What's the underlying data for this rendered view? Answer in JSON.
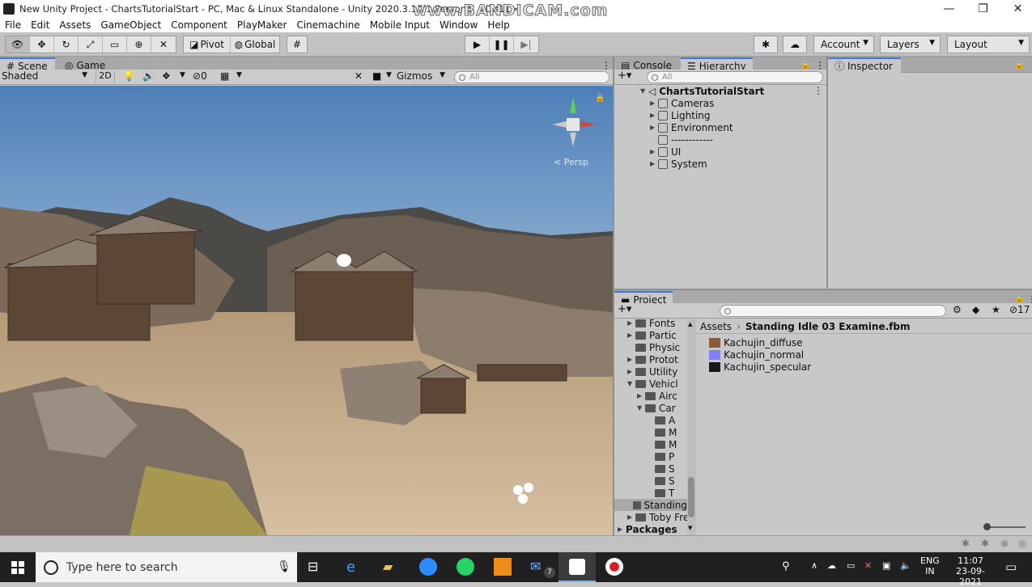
{
  "window": {
    "title": "New Unity Project - ChartsTutorialStart - PC, Mac & Linux Standalone - Unity 2020.3.17f1 Personal <DX11>",
    "watermark": "www.BANDICAM.com",
    "controls": {
      "minimize": "—",
      "restore": "❐",
      "close": "✕"
    }
  },
  "menu": [
    "File",
    "Edit",
    "Assets",
    "GameObject",
    "Component",
    "PlayMaker",
    "Cinemachine",
    "Mobile Input",
    "Window",
    "Help"
  ],
  "toolbar": {
    "pivot_label": "Pivot",
    "global_label": "Global",
    "account_label": "Account",
    "layers_label": "Layers",
    "layout_label": "Layout",
    "count_badge": "17"
  },
  "scene_panel": {
    "tab_scene": "Scene",
    "tab_game": "Game",
    "shading_mode": "Shaded",
    "toggle_2d": "2D",
    "hidden_count": "0",
    "gizmos_label": "Gizmos",
    "search_placeholder": "All",
    "persp_label": "< Persp"
  },
  "hierarchy_panel": {
    "tab_console": "Console",
    "tab_hierarchy": "Hierarchy",
    "search_placeholder": "All",
    "scene_name": "ChartsTutorialStart",
    "items": [
      {
        "label": "Cameras",
        "expandable": true
      },
      {
        "label": "Lighting",
        "expandable": true
      },
      {
        "label": "Environment",
        "expandable": true
      },
      {
        "label": "------------",
        "expandable": false
      },
      {
        "label": "UI",
        "expandable": true
      },
      {
        "label": "System",
        "expandable": true
      }
    ]
  },
  "inspector_panel": {
    "tab_inspector": "Inspector"
  },
  "project_panel": {
    "tab_project": "Project",
    "breadcrumb_root": "Assets",
    "breadcrumb_current": "Standing Idle 03 Examine.fbm",
    "tree": [
      {
        "label": "Fonts",
        "indent": 1,
        "open": false
      },
      {
        "label": "Partic",
        "indent": 1,
        "open": false
      },
      {
        "label": "Physic",
        "indent": 1,
        "open": false,
        "noarrow": true
      },
      {
        "label": "Protot",
        "indent": 1,
        "open": false
      },
      {
        "label": "Utility",
        "indent": 1,
        "open": false
      },
      {
        "label": "Vehicl",
        "indent": 1,
        "open": true
      },
      {
        "label": "Airc",
        "indent": 2,
        "open": false
      },
      {
        "label": "Car",
        "indent": 2,
        "open": true
      },
      {
        "label": "A",
        "indent": 3,
        "noarrow": true
      },
      {
        "label": "M",
        "indent": 3,
        "noarrow": true
      },
      {
        "label": "M",
        "indent": 3,
        "noarrow": true
      },
      {
        "label": "P",
        "indent": 3,
        "noarrow": true
      },
      {
        "label": "S",
        "indent": 3,
        "noarrow": true
      },
      {
        "label": "S",
        "indent": 3,
        "noarrow": true
      },
      {
        "label": "T",
        "indent": 3,
        "noarrow": true
      },
      {
        "label": "Standing",
        "indent": 1,
        "noarrow": true,
        "selected": true
      },
      {
        "label": "Toby Fre",
        "indent": 1,
        "open": false
      },
      {
        "label": "Packages",
        "indent": 0,
        "open": false,
        "bold": true
      }
    ],
    "files": [
      {
        "label": "Kachujin_diffuse",
        "color": "#8a5a3c"
      },
      {
        "label": "Kachujin_normal",
        "color": "#8080ff"
      },
      {
        "label": "Kachujin_specular",
        "color": "#1a1a1a"
      }
    ]
  },
  "taskbar": {
    "search_placeholder": "Type here to search",
    "mail_badge": "7",
    "lang_top": "ENG",
    "lang_bottom": "IN",
    "time": "11:07",
    "date": "23-09-2021"
  }
}
